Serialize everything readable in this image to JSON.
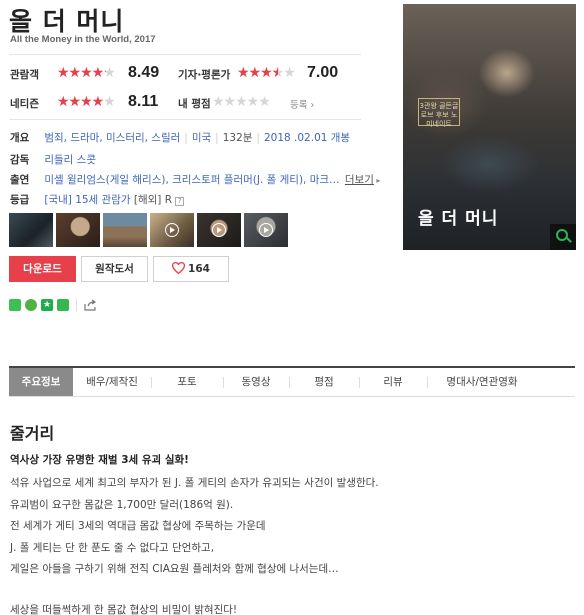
{
  "movie": {
    "title": "올 더 머니",
    "subtitle": "All the Money in the World, 2017"
  },
  "ratings": {
    "audience": {
      "label": "관람객",
      "score": "8.49",
      "value": 8.49
    },
    "critics": {
      "label": "기자·평론가",
      "score": "7.00",
      "value": 7.0
    },
    "netizen": {
      "label": "네티즌",
      "score": "8.11",
      "value": 8.11
    },
    "mine": {
      "label": "내 평점",
      "action": "등록",
      "value": 0
    }
  },
  "info": {
    "overview": {
      "label": "개요",
      "genres": "범죄, 드라마, 미스터리, 스릴러",
      "country": "미국",
      "runtime": "132분",
      "release": "2018 .02.01 개봉"
    },
    "director": {
      "label": "감독",
      "value": "리들리 스콧"
    },
    "cast": {
      "label": "출연",
      "value": "미셸 윌리엄스(게일 해리스), 크리스토퍼 플러머(J. 폴 게티), 마크…",
      "more": "더보기"
    },
    "grade": {
      "label": "등급",
      "domestic": "[국내] 15세 관람가",
      "foreign": "[해외] R"
    }
  },
  "poster": {
    "badge": "3관왕 골든글로브 후보 노미네이트",
    "title": "올 더 머니"
  },
  "buttons": {
    "download": "다운로드",
    "book": "원작도서",
    "likes": "164"
  },
  "tabs": [
    "주요정보",
    "배우/제작진",
    "포토",
    "동영상",
    "평점",
    "리뷰",
    "명대사/연관영화"
  ],
  "synopsis": {
    "heading": "줄거리",
    "lead": "역사상 가장 유명한 재벌 3세 유괴 실화!",
    "lines": [
      "석유 사업으로 세계 최고의 부자가 된 J. 폴 게티의 손자가 유괴되는 사건이 발생한다.",
      "유괴범이 요구한 몸값은 1,700만 달러(186억 원).",
      "전 세계가 게티 3세의 역대급 몸값 협상에 주목하는 가운데",
      "J. 폴 게티는 단 한 푼도 줄 수 없다고 단언하고,",
      "게일은 아들을 구하기 위해 전직 CIA요원 플레처와 함께 협상에 나서는데…"
    ],
    "closing": "세상을 떠들썩하게 한 몸값 협상의 비밀이 밝혀진다!"
  },
  "colors": {
    "accent_red": "#e8404a",
    "link_blue": "#3f66b7",
    "active_tab": "#8a8a8a"
  }
}
